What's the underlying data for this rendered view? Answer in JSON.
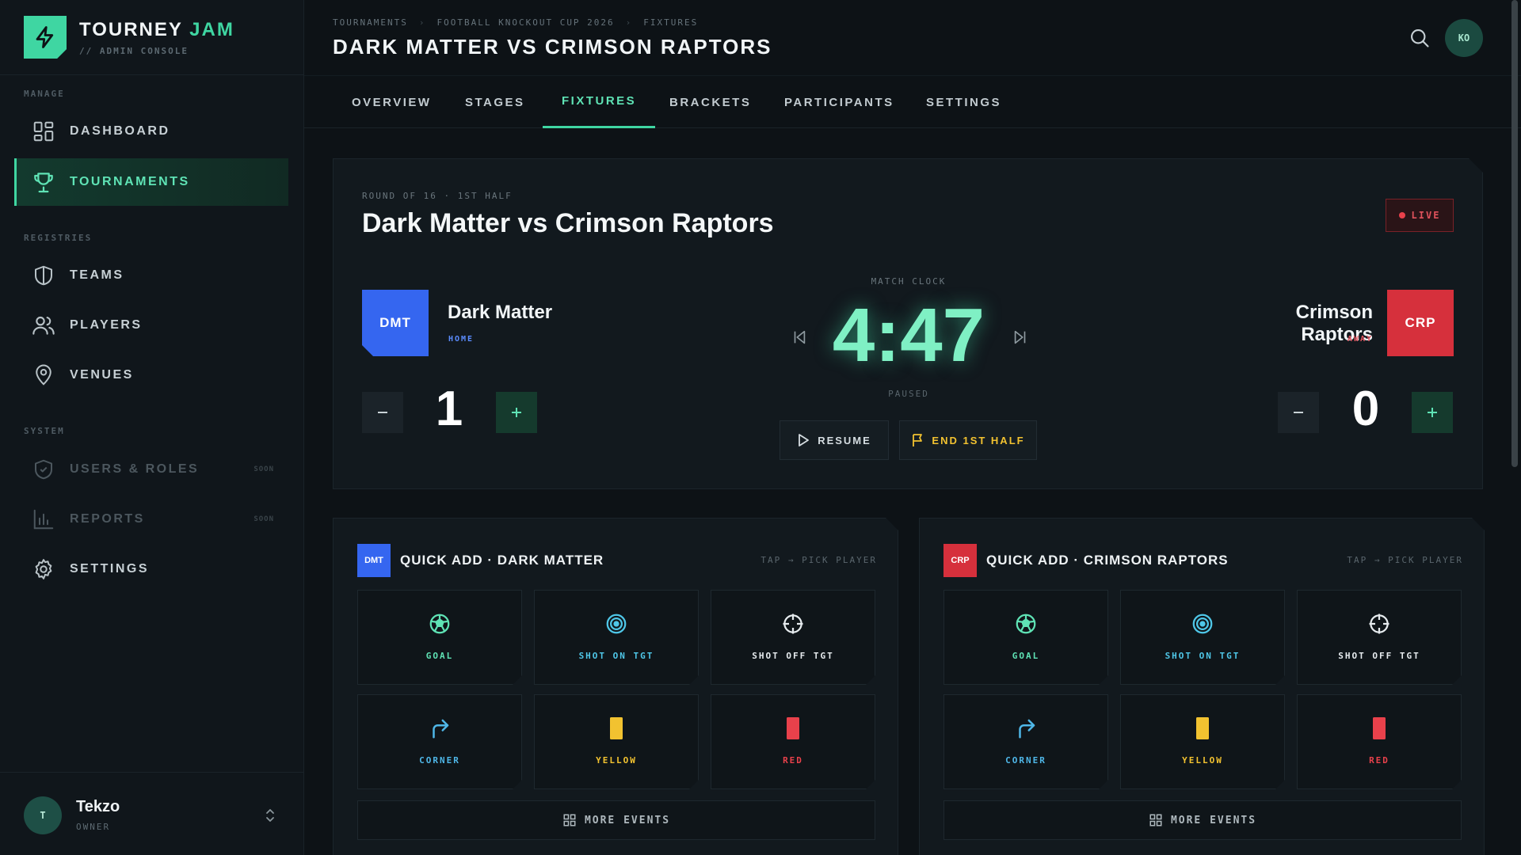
{
  "brand": {
    "title_main": "TOURNEY",
    "title_accent": "JAM",
    "subtitle": "// ADMIN CONSOLE",
    "accent_color": "#3fd6a2"
  },
  "sidebar": {
    "sections": {
      "manage": "MANAGE",
      "registries": "REGISTRIES",
      "system": "SYSTEM"
    },
    "items": [
      {
        "label": "DASHBOARD",
        "icon": "dashboard-grid-icon"
      },
      {
        "label": "TOURNAMENTS",
        "icon": "trophy-icon",
        "active": true
      },
      {
        "label": "TEAMS",
        "icon": "shield-icon"
      },
      {
        "label": "PLAYERS",
        "icon": "users-icon"
      },
      {
        "label": "VENUES",
        "icon": "map-pin-icon"
      },
      {
        "label": "USERS & ROLES",
        "icon": "shield-check-icon",
        "badge": "SOON",
        "disabled": true
      },
      {
        "label": "REPORTS",
        "icon": "bar-chart-icon",
        "badge": "SOON",
        "disabled": true
      },
      {
        "label": "SETTINGS",
        "icon": "gear-icon"
      }
    ],
    "user": {
      "initial": "T",
      "name": "Tekzo",
      "role": "OWNER"
    }
  },
  "header": {
    "breadcrumbs": [
      "TOURNAMENTS",
      "FOOTBALL KNOCKOUT CUP 2026",
      "FIXTURES"
    ],
    "title": "DARK MATTER VS CRIMSON RAPTORS",
    "avatar": "KO"
  },
  "tabs": [
    "OVERVIEW",
    "STAGES",
    "FIXTURES",
    "BRACKETS",
    "PARTICIPANTS",
    "SETTINGS"
  ],
  "active_tab": "FIXTURES",
  "match": {
    "round": "ROUND OF 16 · 1ST HALF",
    "title": "Dark Matter vs Crimson Raptors",
    "status": "LIVE",
    "clock_label": "MATCH CLOCK",
    "clock": "4:47",
    "clock_state": "PAUSED",
    "resume_label": "RESUME",
    "end_half_label": "END 1ST HALF",
    "home": {
      "abbr": "DMT",
      "name": "Dark Matter",
      "side": "HOME",
      "score": "1",
      "color": "#3566f0"
    },
    "away": {
      "abbr": "CRP",
      "name": "Crimson Raptors",
      "side": "AWAY",
      "score": "0",
      "color": "#d6303c"
    }
  },
  "quick_add": {
    "hint": "TAP → PICK PLAYER",
    "more_label": "MORE EVENTS",
    "home_title": "QUICK ADD · DARK MATTER",
    "away_title": "QUICK ADD · CRIMSON RAPTORS",
    "events": [
      {
        "label": "GOAL",
        "icon": "football-icon",
        "color": "#5fe3b5"
      },
      {
        "label": "SHOT ON TGT",
        "icon": "target-icon",
        "color": "#4fc7e8"
      },
      {
        "label": "SHOT OFF TGT",
        "icon": "crosshair-icon",
        "color": "#e6ebee"
      },
      {
        "label": "CORNER",
        "icon": "corner-arrow-icon",
        "color": "#4fb7e8"
      },
      {
        "label": "YELLOW",
        "icon": "yellow-card-icon",
        "color": "#f2c230"
      },
      {
        "label": "RED",
        "icon": "red-card-icon",
        "color": "#e8414b"
      }
    ]
  }
}
